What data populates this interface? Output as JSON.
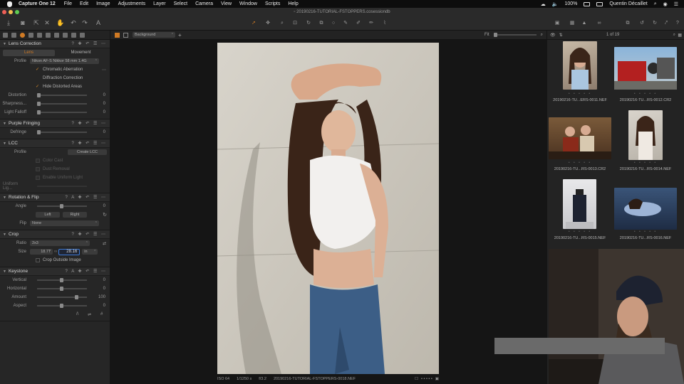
{
  "menubar": {
    "app_name": "Capture One 12",
    "menus": [
      "File",
      "Edit",
      "Image",
      "Adjustments",
      "Layer",
      "Select",
      "Camera",
      "View",
      "Window",
      "Scripts",
      "Help"
    ],
    "battery": "100%",
    "user": "Quentin Décaillet"
  },
  "window_title": "20190216-TUTORIAL-FSTOPPERS.cosessiondb",
  "lens_correction": {
    "title": "Lens Correction",
    "tabs": [
      "Lens",
      "Movement"
    ],
    "profile_label": "Profile",
    "profile_value": "Nikon AF-S Nikkor 58 mm 1.4G",
    "checks": [
      "Chromatic Aberration",
      "Diffraction Correction",
      "Hide Distorted Areas"
    ],
    "sliders": [
      {
        "label": "Distortion",
        "value": "0",
        "level": 0
      },
      {
        "label": "Sharpness...",
        "value": "0",
        "level": 0
      },
      {
        "label": "Light Falloff",
        "value": "0",
        "level": 0
      }
    ]
  },
  "purple_fringing": {
    "title": "Purple Fringing",
    "label": "Defringe",
    "value": "0"
  },
  "lcc": {
    "title": "LCC",
    "profile_label": "Profile",
    "create_button": "Create LCC",
    "checks": [
      "Color Cast",
      "Dust Removal",
      "Enable Uniform Light"
    ],
    "uniform_label": "Uniform Lig..."
  },
  "rotation": {
    "title": "Rotation & Flip",
    "angle_label": "Angle",
    "angle_value": "0",
    "left_button": "Left",
    "right_button": "Right",
    "flip_label": "Flip",
    "flip_value": "None"
  },
  "crop": {
    "title": "Crop",
    "ratio_label": "Ratio",
    "ratio_value": "2x3",
    "size_label": "Size",
    "width": "18.77",
    "height": "28.16",
    "unit": "in",
    "outside_check": "Crop Outside Image"
  },
  "keystone": {
    "title": "Keystone",
    "sliders": [
      {
        "label": "Vertical",
        "value": "0",
        "level": 0.5
      },
      {
        "label": "Horizontal",
        "value": "0",
        "level": 0.5
      },
      {
        "label": "Amount",
        "value": "100",
        "level": 0.8
      },
      {
        "label": "Aspect",
        "value": "0",
        "level": 0.5
      }
    ]
  },
  "viewer": {
    "style_value": "Background",
    "fit_label": "Fit",
    "iso": "ISO 64",
    "shutter": "1/1250 s",
    "aperture": "f/3.2",
    "filename": "20190216-TUTORIAL-FSTOPPERS-0018.NEF"
  },
  "browser": {
    "counter": "1 of 19",
    "thumbs": [
      {
        "name": "20190216-TU...ERS-0011.NEF"
      },
      {
        "name": "20190216-TU...RS-0012.CR2"
      },
      {
        "name": "20190216-TU...RS-0013.CR2"
      },
      {
        "name": "20190216-TU...RS-0014.NEF"
      },
      {
        "name": "20190216-TU...RS-0015.NEF"
      },
      {
        "name": "20190216-TU...RS-0016.NEF"
      }
    ],
    "stars": "• • • • •"
  },
  "colors": {
    "accent": "#d07a24",
    "panel": "#262626",
    "viewer_bg": "#151515"
  }
}
